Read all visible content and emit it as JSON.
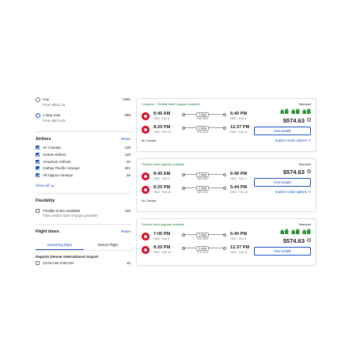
{
  "stops": [
    {
      "label": "Any",
      "sub": "From $541.41",
      "count": "1301",
      "selected": false
    },
    {
      "label": "1 stop max",
      "sub": "From $574.63",
      "count": "288",
      "selected": true
    }
  ],
  "airlines": {
    "title": "Airlines",
    "reset": "Reset",
    "items": [
      {
        "label": "Air Canada",
        "count": "138"
      },
      {
        "label": "United Airlines",
        "count": "129"
      },
      {
        "label": "American Airlines",
        "count": "40"
      },
      {
        "label": "Cathay Pacific Airways",
        "count": "181"
      },
      {
        "label": "All Nippon Airways",
        "count": "35"
      }
    ],
    "show_all": "Show all"
  },
  "flexibility": {
    "title": "Flexibility",
    "option_label": "Flexible ticket available",
    "option_sub": "Time and/or date change possible",
    "count": "130"
  },
  "flight_times": {
    "title": "Flight times",
    "reset": "Reset",
    "tabs": [
      "Departing flight",
      "Return flight"
    ],
    "depart_heading": "Departs Denver International Airport",
    "slot_label": "12:00 AM–5:59 AM",
    "slot_count": "10"
  },
  "cards": [
    {
      "tags": [
        "Cheapest",
        "Flexible ticket upgrade available"
      ],
      "fare": "Standard",
      "legs": [
        {
          "dep": "8:45 AM",
          "dep_sub": "DEN · Feb 3",
          "stop": "1 stop",
          "dur": "18h 55m",
          "arr": "6:40 PM",
          "arr_sub": "HKG · Feb 4"
        },
        {
          "dep": "8:25 PM",
          "dep_sub": "HKG · Feb 10",
          "stop": "1 stop",
          "dur": "21h 12m",
          "arr": "12:37 PM",
          "arr_sub": "DEN · Feb 11"
        }
      ],
      "airline": "Air Canada",
      "price": "$574.63",
      "view": "View details",
      "explore": "Explore ticket options"
    },
    {
      "tags": [
        "Flexible ticket upgrade available"
      ],
      "fare": "Standard",
      "legs": [
        {
          "dep": "8:45 AM",
          "dep_sub": "DEN · Feb 3",
          "stop": "1 stop",
          "dur": "18h 55m",
          "arr": "6:40 PM",
          "arr_sub": "HKG · Feb 4"
        },
        {
          "dep": "8:25 PM",
          "dep_sub": "HKG · Feb 10",
          "stop": "1 stop",
          "dur": "38h 19m",
          "arr": "5:44 PM",
          "arr_sub": "DEN · Feb 12"
        }
      ],
      "airline": "Air Canada",
      "price": "$574.63",
      "view": "View details",
      "explore": "Explore ticket options"
    },
    {
      "tags": [
        "Flexible ticket upgrade available"
      ],
      "fare": "Standard",
      "legs": [
        {
          "dep": "7:05 PM",
          "dep_sub": "DEN · Feb 3",
          "stop": "1 stop",
          "dur": "32h 35m",
          "arr": "6:40 PM",
          "arr_sub": "HKG · Feb 5"
        },
        {
          "dep": "8:25 PM",
          "dep_sub": "HKG · Feb 10",
          "stop": "1 stop",
          "dur": "21h 12m",
          "arr": "12:37 PM",
          "arr_sub": "DEN · Feb 11"
        }
      ],
      "airline": "",
      "price": "$574.63",
      "view": "View details",
      "explore": ""
    }
  ],
  "colors": {
    "accent": "#1a4fc2",
    "brand": "#d6001c",
    "deal": "#1a7f37"
  },
  "icons": {
    "airline_logo": "maple-leaf-icon",
    "baggage": "bag-icon",
    "info": "info-icon",
    "expand": "chevron-down-icon"
  }
}
